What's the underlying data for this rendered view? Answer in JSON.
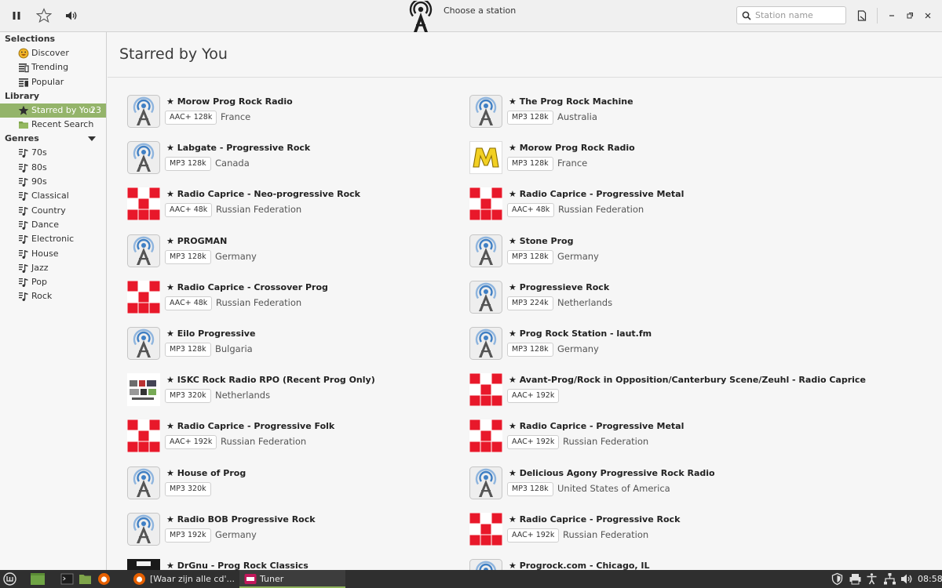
{
  "header": {
    "title": "Choose a station",
    "search_placeholder": "Station name"
  },
  "sidebar": {
    "sections": {
      "selections": "Selections",
      "library": "Library",
      "genres": "Genres"
    },
    "selections": [
      {
        "label": "Discover",
        "icon": "discover-icon"
      },
      {
        "label": "Trending",
        "icon": "trending-icon"
      },
      {
        "label": "Popular",
        "icon": "popular-icon"
      }
    ],
    "library": [
      {
        "label": "Starred by You",
        "count": "23",
        "icon": "starred-icon"
      },
      {
        "label": "Recent Search",
        "icon": "folder-icon"
      }
    ],
    "genres": [
      "70s",
      "80s",
      "90s",
      "Classical",
      "Country",
      "Dance",
      "Electronic",
      "House",
      "Jazz",
      "Pop",
      "Rock"
    ]
  },
  "main": {
    "page_title": "Starred by You",
    "stations": [
      {
        "name": "★ Morow Prog Rock Radio",
        "badge": "AAC+ 128k",
        "country": "France",
        "logo": "tower"
      },
      {
        "name": "★ The Prog Rock Machine",
        "badge": "MP3 128k",
        "country": "Australia",
        "logo": "tower"
      },
      {
        "name": "★ Labgate - Progressive Rock",
        "badge": "MP3 128k",
        "country": "Canada",
        "logo": "tower"
      },
      {
        "name": "★ Morow Prog Rock Radio",
        "badge": "MP3 128k",
        "country": "France",
        "logo": "m-yellow"
      },
      {
        "name": "★ Radio Caprice - Neo-progressive Rock",
        "badge": "AAC+ 48k",
        "country": "Russian Federation",
        "logo": "caprice"
      },
      {
        "name": "★ Radio Caprice - Progressive Metal",
        "badge": "AAC+ 48k",
        "country": "Russian Federation",
        "logo": "caprice"
      },
      {
        "name": "★ PROGMAN",
        "badge": "MP3 128k",
        "country": "Germany",
        "logo": "tower"
      },
      {
        "name": "★ Stone Prog",
        "badge": "MP3 128k",
        "country": "Germany",
        "logo": "tower"
      },
      {
        "name": "★ Radio Caprice - Crossover Prog",
        "badge": "AAC+ 48k",
        "country": "Russian Federation",
        "logo": "caprice"
      },
      {
        "name": "★ Progressieve Rock",
        "badge": "MP3 224k",
        "country": "Netherlands",
        "logo": "tower"
      },
      {
        "name": "★ Eilo Progressive",
        "badge": "MP3 128k",
        "country": "Bulgaria",
        "logo": "tower"
      },
      {
        "name": "★ Prog Rock Station - laut.fm",
        "badge": "MP3 128k",
        "country": "Germany",
        "logo": "tower"
      },
      {
        "name": "★ ISKC Rock Radio RPO (Recent Prog Only)",
        "badge": "MP3 320k",
        "country": "Netherlands",
        "logo": "collage"
      },
      {
        "name": "★ Avant-Prog/Rock in Opposition/Canterbury Scene/Zeuhl - Radio Caprice",
        "badge": "AAC+ 192k",
        "country": "",
        "logo": "caprice"
      },
      {
        "name": "★ Radio Caprice - Progressive Folk",
        "badge": "AAC+ 192k",
        "country": "Russian Federation",
        "logo": "caprice"
      },
      {
        "name": "★ Radio Caprice - Progressive Metal",
        "badge": "AAC+ 192k",
        "country": "Russian Federation",
        "logo": "caprice"
      },
      {
        "name": "★ House of Prog",
        "badge": "MP3 320k",
        "country": "",
        "logo": "tower"
      },
      {
        "name": "★ Delicious Agony Progressive Rock Radio",
        "badge": "MP3 128k",
        "country": "United States of America",
        "logo": "tower"
      },
      {
        "name": "★ Radio BOB Progressive Rock",
        "badge": "MP3 192k",
        "country": "Germany",
        "logo": "tower"
      },
      {
        "name": "★ Radio Caprice - Progressive Rock",
        "badge": "AAC+ 192k",
        "country": "Russian Federation",
        "logo": "caprice"
      },
      {
        "name": "★ DrGnu - Prog Rock Classics",
        "badge": "",
        "country": "",
        "logo": "dark"
      },
      {
        "name": "★ Progrock.com - Chicago, IL",
        "badge": "",
        "country": "",
        "logo": "tower"
      }
    ]
  },
  "taskbar": {
    "tasks": [
      {
        "label": "[Waar zijn alle cd'..."
      },
      {
        "label": "Tuner"
      }
    ],
    "clock": "08:58"
  },
  "colors": {
    "accent": "#94b46a",
    "caprice_red": "#e8182a",
    "tower_blue": "#3f7fc4"
  }
}
